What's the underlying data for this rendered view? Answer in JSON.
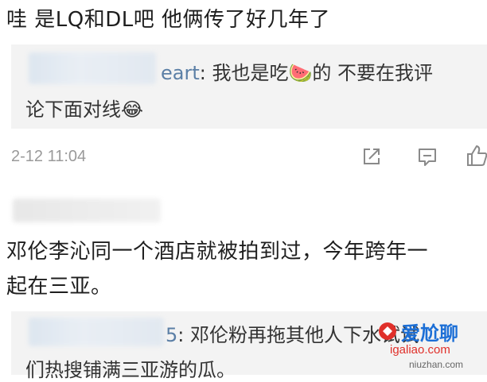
{
  "comment1": {
    "text": "哇 是LQ和DL吧 他俩传了好几年了",
    "quote": {
      "name_tail": "eart",
      "line1_a": ": 我也是吃",
      "emoji1": "🍉",
      "line1_b": "的 不要在我评",
      "line2": "论下面对线",
      "emoji2": "😂"
    },
    "timestamp": "2-12 11:04",
    "actions": {
      "share_icon": "share-icon",
      "comment_icon": "comment-icon",
      "like_icon": "like-icon"
    }
  },
  "comment2": {
    "line1": "邓伦李沁同一个酒店就被拍到过，今年跨年一",
    "line2": "起在三亚。",
    "quote": {
      "name_tail": "5",
      "line1": ": 邓伦粉再拖其他人下水试试",
      "line2": "们热搜铺满三亚游的瓜。"
    }
  },
  "watermark": {
    "brand": "爱尬聊",
    "url": "igaliao.com",
    "sub": "niuzhan.com"
  },
  "colors": {
    "quote_bg": "#f3f3f3",
    "timestamp": "#9a9a9a",
    "watermark_blue": "#1c6fd6",
    "watermark_red": "#e0302a"
  }
}
